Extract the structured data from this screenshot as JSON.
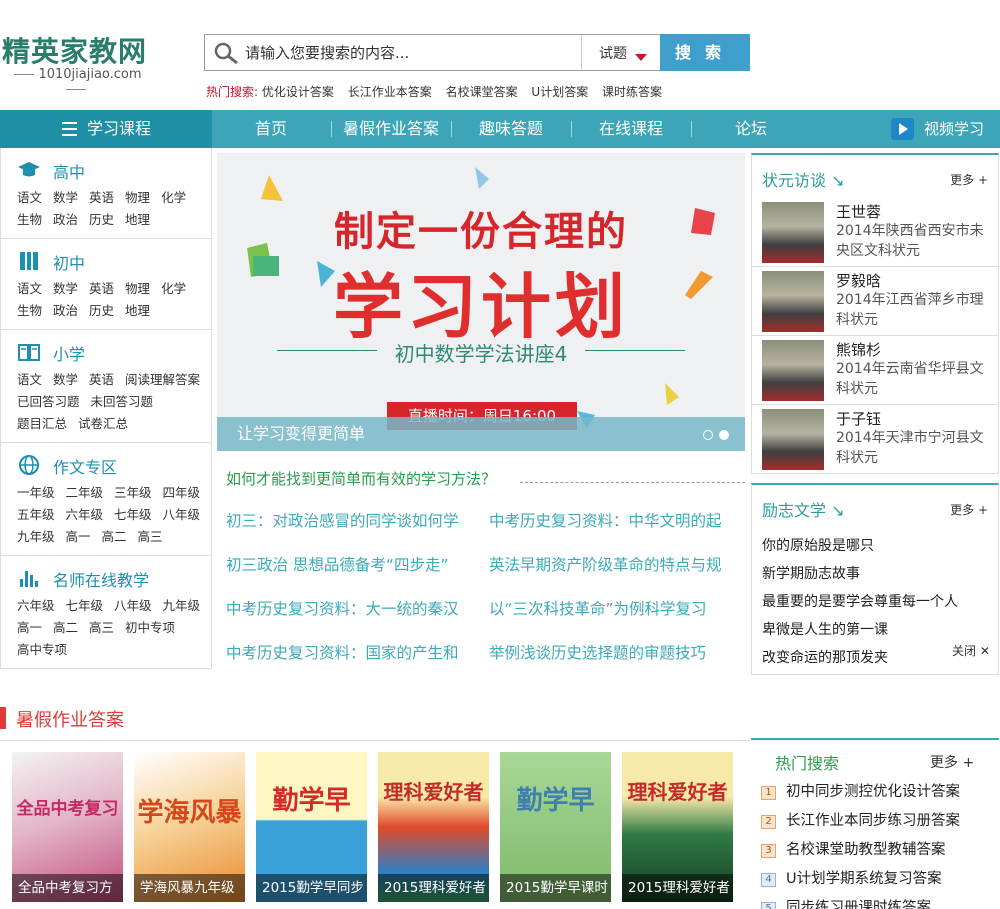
{
  "logo": {
    "name": "精英家教网",
    "url": "1010jiajiao.com"
  },
  "search": {
    "placeholder": "请输入您要搜索的内容...",
    "type": "试题",
    "button": "搜索"
  },
  "hot_search": {
    "label": "热门搜索:",
    "links": [
      "优化设计答案",
      "长江作业本答案",
      "名校课堂答案",
      "U计划答案",
      "课时练答案"
    ]
  },
  "nav": {
    "courses": "学习课程",
    "items": [
      "首页",
      "暑假作业答案",
      "趣味答题",
      "在线课程",
      "论坛"
    ],
    "video": "视频学习"
  },
  "sidebar": [
    {
      "title": "高中",
      "icon": "graduation-cap-icon",
      "links": [
        "语文",
        "数学",
        "英语",
        "物理",
        "化学",
        "生物",
        "政治",
        "历史",
        "地理"
      ]
    },
    {
      "title": "初中",
      "icon": "books-icon",
      "links": [
        "语文",
        "数学",
        "英语",
        "物理",
        "化学",
        "生物",
        "政治",
        "历史",
        "地理"
      ]
    },
    {
      "title": "小学",
      "icon": "open-book-icon",
      "links": [
        "语文",
        "数学",
        "英语",
        "阅读理解答案",
        "已回答习题",
        "未回答习题",
        "题目汇总",
        "试卷汇总"
      ]
    },
    {
      "title": "作文专区",
      "icon": "globe-icon",
      "links": [
        "一年级",
        "二年级",
        "三年级",
        "四年级",
        "五年级",
        "六年级",
        "七年级",
        "八年级",
        "九年级",
        "高一",
        "高二",
        "高三"
      ]
    },
    {
      "title": "名师在线教学",
      "icon": "chart-bars-icon",
      "links": [
        "六年级",
        "七年级",
        "八年级",
        "九年级",
        "高一",
        "高二",
        "高三",
        "初中专项",
        "高中专项"
      ]
    }
  ],
  "banner": {
    "title_line1": "制定一份合理的",
    "title_line2": "学习计划",
    "subtitle": "初中数学学法讲座4",
    "live_time": "直播时间：周日16:00",
    "caption": "让学习变得更简单"
  },
  "articles": {
    "headline": "如何才能找到更简单而有效的学习方法？",
    "left": [
      "初三：对政治感冒的同学谈如何学",
      "初三政治  思想品德备考“四步走”",
      "中考历史复习资料：大一统的秦汉",
      "中考历史复习资料：国家的产生和"
    ],
    "right": [
      "中考历史复习资料：中华文明的起",
      "英法早期资产阶级革命的特点与规",
      "以“三次科技革命”为例科学复习",
      "举例浅谈历史选择题的审题技巧"
    ]
  },
  "champions": {
    "title": "状元访谈",
    "more": "更多 +",
    "people": [
      {
        "name": "王世蓉",
        "desc": "2014年陕西省西安市未央区文科状元"
      },
      {
        "name": "罗毅晗",
        "desc": "2014年江西省萍乡市理科状元"
      },
      {
        "name": "熊锦杉",
        "desc": "2014年云南省华坪县文科状元"
      },
      {
        "name": "于子钰",
        "desc": "2014年天津市宁河县文科状元"
      }
    ]
  },
  "inspire": {
    "title": "励志文学",
    "more": "更多 +",
    "items": [
      "你的原始股是哪只",
      "新学期励志故事",
      "最重要的是要学会尊重每一个人",
      "卑微是人生的第一课",
      "改变命运的那顶发夹"
    ],
    "close": "关闭"
  },
  "summer": {
    "title": "暑假作业答案",
    "books": [
      {
        "title": "全品中考复习方",
        "brand": "全品中考复习",
        "color": "#c44b7a"
      },
      {
        "title": "学海风暴九年级",
        "brand": "学海风暴",
        "color": "#e98a2c"
      },
      {
        "title": "2015勤学早同步",
        "brand": "勤学早",
        "color": "#3aa0d8"
      },
      {
        "title": "2015理科爱好者",
        "brand": "理科爱好者",
        "color": "#e14a2a"
      },
      {
        "title": "2015勤学早课时",
        "brand": "勤学早",
        "color": "#7fb96a"
      },
      {
        "title": "2015理科爱好者",
        "brand": "理科爱好者",
        "color": "#2e7a45"
      }
    ]
  },
  "hot_searches": {
    "title": "热门搜索",
    "more": "更多 +",
    "items": [
      "初中同步测控优化设计答案",
      "长江作业本同步练习册答案",
      "名校课堂助教型教辅答案",
      "U计划学期系统复习答案",
      "同步练习册课时练答案"
    ],
    "numbers": [
      "1",
      "2",
      "3",
      "4",
      "5"
    ]
  }
}
